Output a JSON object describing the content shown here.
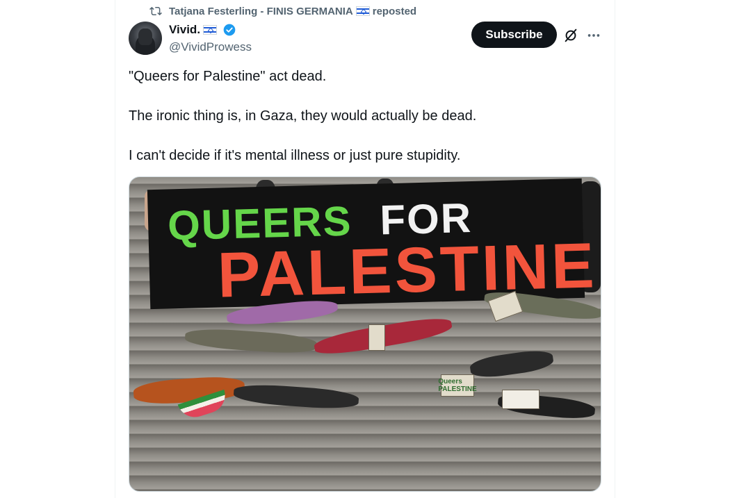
{
  "repost": {
    "user": "Tatjana Festerling - FINIS GERMANIA",
    "action": "reposted"
  },
  "author": {
    "name": "Vivid.",
    "handle": "@VividProwess"
  },
  "actions": {
    "subscribe": "Subscribe"
  },
  "tweet": {
    "line1": "\"Queers for Palestine\" act dead.",
    "line2": "The ironic thing is, in Gaza, they would actually be dead.",
    "line3": "I can't decide if it's mental illness or just pure stupidity."
  },
  "media": {
    "banner": {
      "word1": "QUEERS",
      "word2": "FOR",
      "word3": "PALESTINE"
    },
    "sign_text": "Queers PALESTINE"
  },
  "colors": {
    "accent": "#1d9bf0",
    "banner_green": "#65d64a",
    "banner_red": "#f2543c"
  }
}
